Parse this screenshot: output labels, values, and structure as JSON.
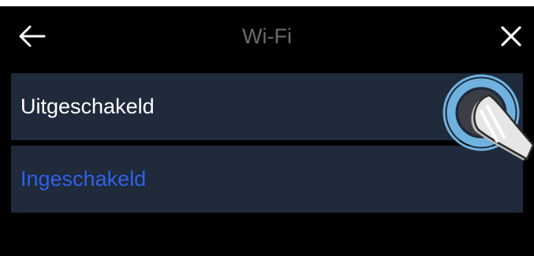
{
  "header": {
    "title": "Wi-Fi",
    "back_icon": "arrow-left-icon",
    "close_icon": "close-icon"
  },
  "options": [
    {
      "label": "Uitgeschakeld",
      "color": "#ffffff"
    },
    {
      "label": "Ingeschakeld",
      "color": "#2f61e8"
    }
  ],
  "overlay": {
    "icon": "finger-tap-icon",
    "ring_color": "#6fb2e0"
  }
}
